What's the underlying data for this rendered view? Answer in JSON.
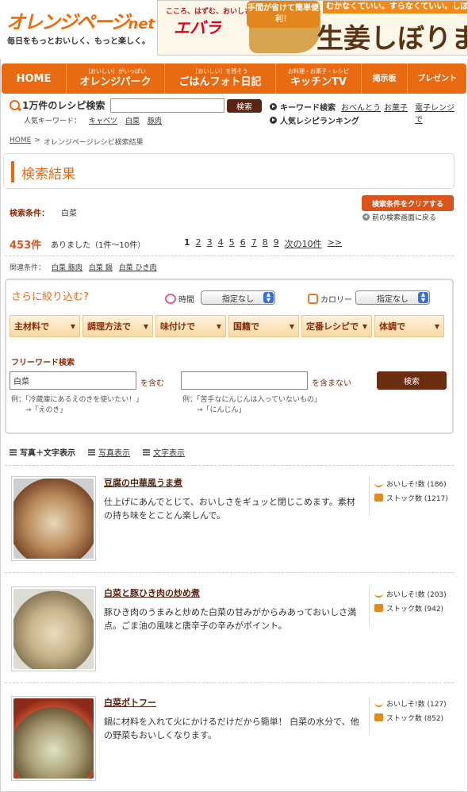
{
  "header": {
    "logo_main": "オレンジページ",
    "logo_net": "net",
    "tagline": "毎日をもっとおいしく、もっと楽しく。",
    "ad": {
      "tag": "こころ、はずむ、おいしさ。",
      "brand": "エバラ",
      "bubble": "手間が省けて簡単便利！",
      "slogan": "むかなくていい。すらなくていい。しぼ",
      "title": "生姜しぼりま"
    }
  },
  "nav": [
    {
      "small": "",
      "big": "HOME"
    },
    {
      "small": "［おいしい］がいっぱい",
      "big": "オレンジパーク"
    },
    {
      "small": "［おいしい］を残そう",
      "big": "ごはんフォト日記"
    },
    {
      "small": "お料理・お菓子・レシピ",
      "big": "キッチンTV"
    },
    {
      "small": "",
      "big": "掲示板"
    },
    {
      "small": "",
      "big": "プレゼント"
    }
  ],
  "search": {
    "label": "1万件のレシピ検索",
    "input_value": "",
    "button": "検索",
    "keyword_search": "キーワード検索",
    "keyword_links": [
      "おべんとう",
      "お菓子",
      "電子レンジで"
    ],
    "popular_label": "人気キーワード：",
    "popular_links": [
      "キャベツ",
      "白菜",
      "豚肉"
    ],
    "ranking": "人気レシピランキング"
  },
  "breadcrumb": {
    "home": "HOME",
    "sep": ">",
    "current": "オレンジページレシピ検索結果"
  },
  "page_title": "検索結果",
  "conditions": {
    "label": "検索条件：",
    "value": "白菜",
    "clear_button": "検索条件をクリアする",
    "back_link": "前の検索画面に戻る"
  },
  "results": {
    "count": "453件",
    "text": "ありました（1件〜10件）",
    "pages": [
      "1",
      "2",
      "3",
      "4",
      "5",
      "6",
      "7",
      "8",
      "9"
    ],
    "next": "次の10件",
    "last": ">>"
  },
  "related": {
    "label": "関連条件：",
    "links": [
      "白菜 豚肉",
      "白菜 鍋",
      "白菜 ひき肉"
    ]
  },
  "refine": {
    "title": "さらに絞り込む?",
    "time_label": "時間",
    "time_value": "指定なし",
    "calorie_label": "カロリー",
    "calorie_value": "指定なし",
    "tabs": [
      "主材料で",
      "調理方法で",
      "味付けで",
      "国籍で",
      "定番レシピで",
      "体調で"
    ],
    "freeword_label": "フリーワード検索",
    "include_value": "白菜",
    "include_text": "を含む",
    "exclude_value": "",
    "exclude_text": "を含まない",
    "button": "検索",
    "example1_line1": "例：「冷蔵庫にあるえのきを使いたい！」",
    "example1_line2": "→「えのき」",
    "example2_line1": "例：「苦手なにんじんは入っていないもの」",
    "example2_line2": "→「にんじん」"
  },
  "views": [
    "写真＋文字表示",
    "写真表示",
    "文字表示"
  ],
  "recipes": [
    {
      "title": "豆腐の中華風うま煮",
      "desc": "仕上げにあんでとじて、おいしさをギュッと閉じこめます。素材の持ち味をとことん楽しんで。",
      "oishiso": "おいしそ!数 (186)",
      "stock": "ストック数 (1217)",
      "photo_color": "#b98b5c"
    },
    {
      "title": "白菜と豚ひき肉の炒め煮",
      "desc": "豚ひき肉のうまみと炒めた白菜の甘みがからみあっておいしさ満点。ごま油の風味と唐辛子の辛みがポイント。",
      "oishiso": "おいしそ!数 (203)",
      "stock": "ストック数 (942)",
      "photo_color": "#c9b48a"
    },
    {
      "title": "白菜ポトフー",
      "desc": "鍋に材料を入れて火にかけるだけだから簡単！ 白菜の水分で、他の野菜もおいしくなります。",
      "oishiso": "おいしそ!数 (127)",
      "stock": "ストック数 (852)",
      "photo_color": "#a89c72"
    }
  ],
  "colors": {
    "accent": "#ea6a12",
    "brown": "#5a2410"
  }
}
